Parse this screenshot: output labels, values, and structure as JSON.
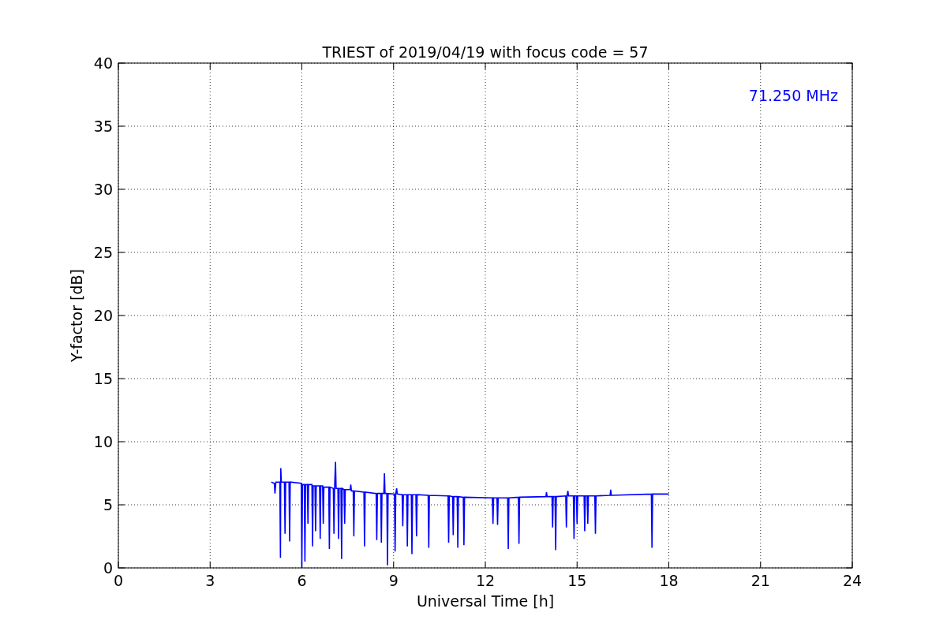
{
  "chart_data": {
    "type": "line",
    "title": "TRIEST of 2019/04/19 with focus code = 57",
    "xlabel": "Universal Time [h]",
    "ylabel": "Y-factor [dB]",
    "xlim": [
      0,
      24
    ],
    "ylim": [
      0,
      40
    ],
    "xticks": [
      0,
      3,
      6,
      9,
      12,
      15,
      18,
      21,
      24
    ],
    "yticks": [
      0,
      5,
      10,
      15,
      20,
      25,
      30,
      35,
      40
    ],
    "grid": true,
    "x": [
      5.0,
      5.1,
      5.12,
      5.15,
      5.28,
      5.3,
      5.31,
      5.33,
      5.43,
      5.45,
      5.47,
      5.58,
      5.6,
      5.62,
      5.98,
      6.0,
      6.02,
      6.08,
      6.1,
      6.12,
      6.18,
      6.2,
      6.22,
      6.33,
      6.35,
      6.37,
      6.43,
      6.45,
      6.47,
      6.58,
      6.6,
      6.62,
      6.68,
      6.7,
      6.72,
      6.88,
      6.9,
      6.92,
      7.03,
      7.05,
      7.07,
      7.1,
      7.12,
      7.18,
      7.2,
      7.22,
      7.28,
      7.3,
      7.32,
      7.38,
      7.4,
      7.42,
      7.58,
      7.6,
      7.62,
      7.68,
      7.7,
      7.72,
      8.03,
      8.05,
      8.07,
      8.43,
      8.45,
      8.47,
      8.58,
      8.6,
      8.62,
      8.68,
      8.7,
      8.72,
      8.78,
      8.8,
      8.82,
      9.03,
      9.05,
      9.07,
      9.1,
      9.12,
      9.28,
      9.3,
      9.32,
      9.43,
      9.45,
      9.47,
      9.58,
      9.6,
      9.62,
      9.73,
      9.75,
      9.77,
      10.13,
      10.15,
      10.17,
      10.78,
      10.8,
      10.82,
      10.93,
      10.95,
      10.97,
      11.08,
      11.1,
      11.12,
      11.28,
      11.3,
      11.32,
      12.23,
      12.25,
      12.27,
      12.38,
      12.4,
      12.42,
      12.73,
      12.75,
      12.77,
      13.08,
      13.1,
      13.12,
      13.98,
      14.0,
      14.02,
      14.18,
      14.2,
      14.22,
      14.28,
      14.3,
      14.32,
      14.63,
      14.65,
      14.67,
      14.7,
      14.72,
      14.88,
      14.9,
      14.92,
      14.98,
      15.0,
      15.02,
      15.23,
      15.25,
      15.27,
      15.33,
      15.35,
      15.37,
      15.58,
      15.6,
      15.62,
      16.08,
      16.1,
      16.12,
      17.43,
      17.45,
      17.47,
      18.0
    ],
    "series": [
      {
        "name": "71.250 MHz",
        "color": "#0000ff",
        "values": [
          6.8,
          6.7,
          5.9,
          6.8,
          6.8,
          0.8,
          7.9,
          6.8,
          6.8,
          2.7,
          6.8,
          6.8,
          2.1,
          6.8,
          6.7,
          0,
          6.6,
          6.6,
          0.5,
          6.6,
          6.6,
          3.5,
          6.6,
          6.6,
          1.7,
          6.5,
          6.5,
          2.9,
          6.5,
          6.5,
          2.3,
          6.5,
          6.5,
          3.5,
          6.4,
          6.4,
          1.5,
          6.4,
          6.3,
          2.7,
          6.3,
          8.4,
          6.3,
          6.3,
          2.3,
          6.3,
          6.3,
          0.7,
          6.3,
          6.2,
          3.5,
          6.2,
          6.2,
          6.6,
          6.1,
          6.1,
          2.5,
          6.1,
          6.0,
          1.7,
          6.0,
          5.9,
          2.2,
          5.9,
          5.9,
          2.0,
          5.9,
          5.9,
          7.5,
          5.9,
          5.9,
          0.2,
          5.9,
          5.85,
          1.3,
          5.85,
          6.3,
          5.85,
          5.8,
          3.3,
          5.8,
          5.8,
          1.7,
          5.8,
          5.8,
          1.1,
          5.8,
          5.8,
          2.5,
          5.8,
          5.75,
          1.6,
          5.75,
          5.7,
          2.0,
          5.7,
          5.65,
          2.6,
          5.65,
          5.65,
          1.6,
          5.65,
          5.6,
          1.8,
          5.6,
          5.55,
          3.5,
          5.55,
          5.55,
          3.4,
          5.55,
          5.55,
          1.5,
          5.55,
          5.6,
          1.9,
          5.6,
          5.65,
          6.0,
          5.65,
          5.65,
          3.2,
          5.65,
          5.65,
          1.4,
          5.65,
          5.7,
          3.2,
          5.7,
          6.1,
          5.7,
          5.7,
          2.3,
          5.7,
          5.7,
          3.5,
          5.7,
          5.7,
          2.9,
          5.7,
          5.7,
          3.5,
          5.7,
          5.7,
          2.7,
          5.7,
          5.75,
          6.2,
          5.75,
          5.85,
          1.6,
          5.85,
          5.85
        ]
      }
    ]
  }
}
